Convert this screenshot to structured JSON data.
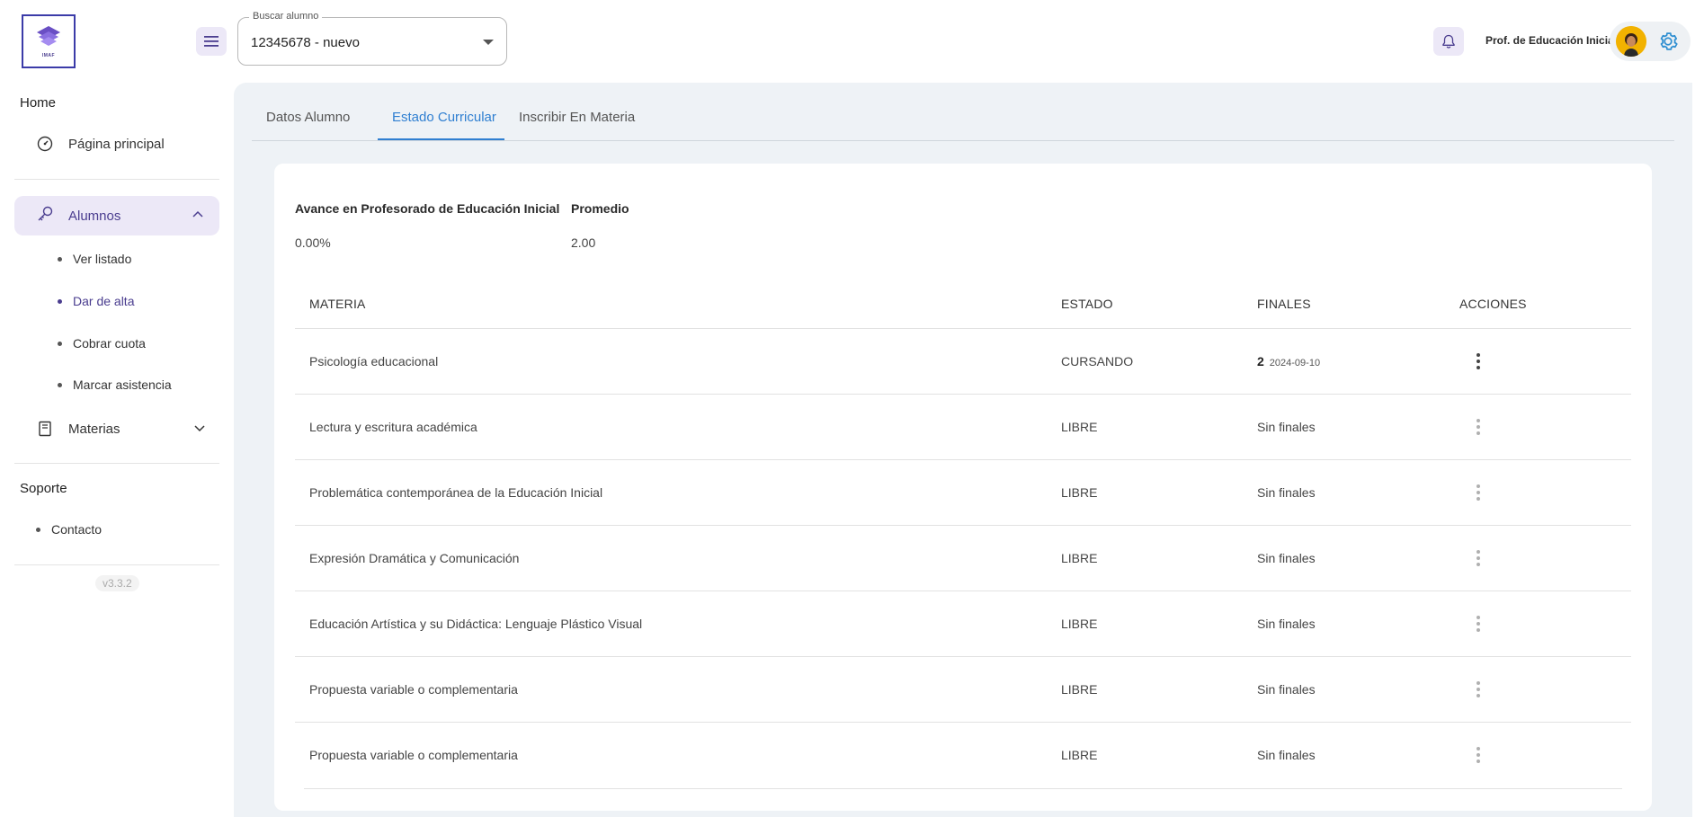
{
  "header": {
    "logo_text": "IMAF",
    "search": {
      "label": "Buscar alumno",
      "value": "12345678 - nuevo"
    },
    "user_name": "Prof. de Educación Inicial"
  },
  "sidebar": {
    "home_title": "Home",
    "home_item": "Página principal",
    "alumnos_label": "Alumnos",
    "alumnos_sub": [
      "Ver listado",
      "Dar de alta",
      "Cobrar cuota",
      "Marcar asistencia"
    ],
    "materias_label": "Materias",
    "support_title": "Soporte",
    "contact": "Contacto",
    "version": "v3.3.2"
  },
  "tabs": [
    "Datos Alumno",
    "Estado Curricular",
    "Inscribir En Materia"
  ],
  "summary": {
    "avance_label": "Avance en Profesorado de Educación Inicial",
    "avance_value": "0.00%",
    "promedio_label": "Promedio",
    "promedio_value": "2.00"
  },
  "table": {
    "headers": [
      "MATERIA",
      "ESTADO",
      "FINALES",
      "ACCIONES"
    ],
    "rows": [
      {
        "materia": "Psicología educacional",
        "estado": "CURSANDO",
        "finales_num": "2",
        "finales_date": "2024-09-10",
        "finales": ""
      },
      {
        "materia": "Lectura y escritura académica",
        "estado": "LIBRE",
        "finales": "Sin finales"
      },
      {
        "materia": "Problemática contemporánea de la Educación Inicial",
        "estado": "LIBRE",
        "finales": "Sin finales"
      },
      {
        "materia": "Expresión Dramática y Comunicación",
        "estado": "LIBRE",
        "finales": "Sin finales"
      },
      {
        "materia": "Educación Artística y su Didáctica: Lenguaje Plástico Visual",
        "estado": "LIBRE",
        "finales": "Sin finales"
      },
      {
        "materia": "Propuesta variable o complementaria",
        "estado": "LIBRE",
        "finales": "Sin finales"
      },
      {
        "materia": "Propuesta variable o complementaria",
        "estado": "LIBRE",
        "finales": "Sin finales"
      }
    ]
  },
  "colors": {
    "accent": "#4a3d8f",
    "tab_active": "#2f7fd1",
    "chip_bg": "#ece8f7"
  }
}
